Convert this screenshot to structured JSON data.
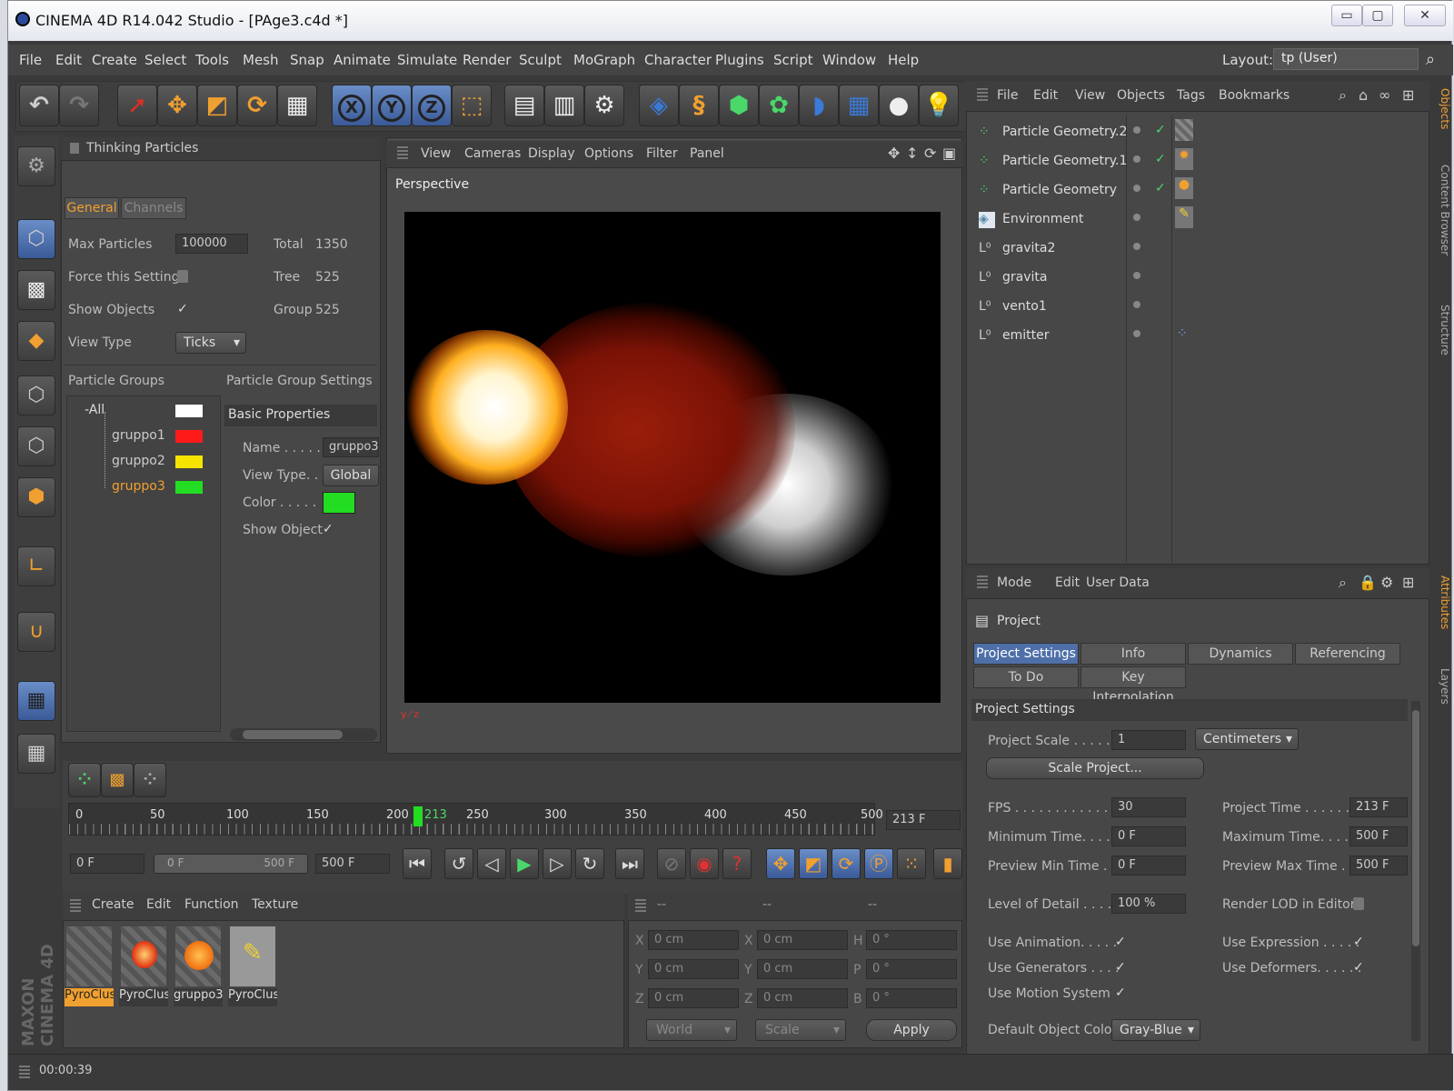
{
  "window": {
    "title": "CINEMA 4D R14.042 Studio - [PAge3.c4d *]",
    "minimize": "▭",
    "maximize": "▢",
    "close": "✕"
  },
  "menu": [
    "File",
    "Edit",
    "Create",
    "Select",
    "Tools",
    "Mesh",
    "Snap",
    "Animate",
    "Simulate",
    "Render",
    "Sculpt",
    "MoGraph",
    "Character",
    "Plugins",
    "Script",
    "Window",
    "Help"
  ],
  "layout": {
    "label": "Layout:",
    "value": "tp (User)"
  },
  "tp": {
    "title": "Thinking Particles",
    "tabs": [
      "General",
      "Channels"
    ],
    "max_particles_label": "Max Particles",
    "max_particles": "100000",
    "force_label": "Force this Setting",
    "show_objects_label": "Show Objects",
    "show_objects_check": "✓",
    "view_type_label": "View Type",
    "view_type": "Ticks",
    "total_label": "Total",
    "total": "1350",
    "tree_label": "Tree",
    "tree": "525",
    "group_label": "Group",
    "group": "525",
    "groups_header": "Particle Groups",
    "settings_header": "Particle Group Settings",
    "groups": [
      {
        "name": "All",
        "color": "#ffffff"
      },
      {
        "name": "gruppo1",
        "color": "#ff1a1a"
      },
      {
        "name": "gruppo2",
        "color": "#f5e400"
      },
      {
        "name": "gruppo3",
        "color": "#22dd22"
      }
    ],
    "basic_props": "Basic Properties",
    "name_label": "Name . . . . . .",
    "name_value": "gruppo3",
    "viewtype_label": "View Type. . .",
    "viewtype_value": "Global",
    "color_label": "Color . . . . .",
    "color_value": "#22dd22",
    "show_object_label": "Show Object",
    "show_object_check": "✓"
  },
  "viewport": {
    "menu": [
      "View",
      "Cameras",
      "Display",
      "Options",
      "Filter",
      "Panel"
    ],
    "label": "Perspective"
  },
  "objects": {
    "menu": [
      "File",
      "Edit",
      "View",
      "Objects",
      "Tags",
      "Bookmarks"
    ],
    "items": [
      "Particle Geometry.2",
      "Particle Geometry.1",
      "Particle Geometry",
      "Environment",
      "gravita2",
      "gravita",
      "vento1",
      "emitter"
    ],
    "check": "✓"
  },
  "attr": {
    "menu": [
      "Mode",
      "Edit",
      "User Data"
    ],
    "title": "Project",
    "tabs1": [
      "Project Settings",
      "Info",
      "Dynamics",
      "Referencing"
    ],
    "tabs2": [
      "To Do",
      "Key Interpolation"
    ],
    "section": "Project Settings",
    "scale_label": "Project Scale . . . . . .",
    "scale_value": "1",
    "scale_unit": "Centimeters",
    "scale_btn": "Scale Project...",
    "fps_label": "FPS . . . . . . . . . . . . . .",
    "fps": "30",
    "ptime_label": "Project Time . . . . . . . .",
    "ptime": "213 F",
    "mintime_label": "Minimum Time. . . . . . .",
    "mintime": "0 F",
    "maxtime_label": "Maximum Time. . . . . . .",
    "maxtime": "500 F",
    "pmin_label": "Preview Min Time . . .",
    "pmin": "0 F",
    "pmax_label": "Preview Max Time . . .",
    "pmax": "500 F",
    "lod_label": "Level of Detail . . . . . . .",
    "lod": "100 %",
    "rlod_label": "Render LOD in Editor",
    "anim_label": "Use Animation. . . . .",
    "expr_label": "Use Expression . . . . .",
    "gen_label": "Use Generators . . . .",
    "def_label": "Use Deformers. . . . . .",
    "motion_label": "Use Motion System",
    "check": "✓",
    "doc_label": "Default Object Color",
    "doc_value": "Gray-Blue"
  },
  "timeline": {
    "ticks": [
      "0",
      "50",
      "100",
      "150",
      "200",
      "213",
      "250",
      "300",
      "350",
      "400",
      "450",
      "500"
    ],
    "current": "213 F",
    "start": "0 F",
    "range_start": "0 F",
    "range_end": "500 F",
    "end": "500 F"
  },
  "materials": {
    "menu": [
      "Create",
      "Edit",
      "Function",
      "Texture"
    ],
    "items": [
      "PyroClus",
      "PyroClus",
      "gruppo3",
      "PyroClus"
    ]
  },
  "coords": {
    "header": [
      "--",
      "--",
      "--"
    ],
    "rows": [
      [
        "X",
        "0 cm",
        "X",
        "0 cm",
        "H",
        "0 °"
      ],
      [
        "Y",
        "0 cm",
        "Y",
        "0 cm",
        "P",
        "0 °"
      ],
      [
        "Z",
        "0 cm",
        "Z",
        "0 cm",
        "B",
        "0 °"
      ]
    ],
    "world": "World",
    "scale": "Scale",
    "apply": "Apply"
  },
  "status": {
    "time": "00:00:39"
  },
  "side_tabs": [
    "Objects",
    "Content Browser",
    "Structure",
    "Attributes",
    "Layers"
  ],
  "brand": "MAXON CINEMA 4D"
}
